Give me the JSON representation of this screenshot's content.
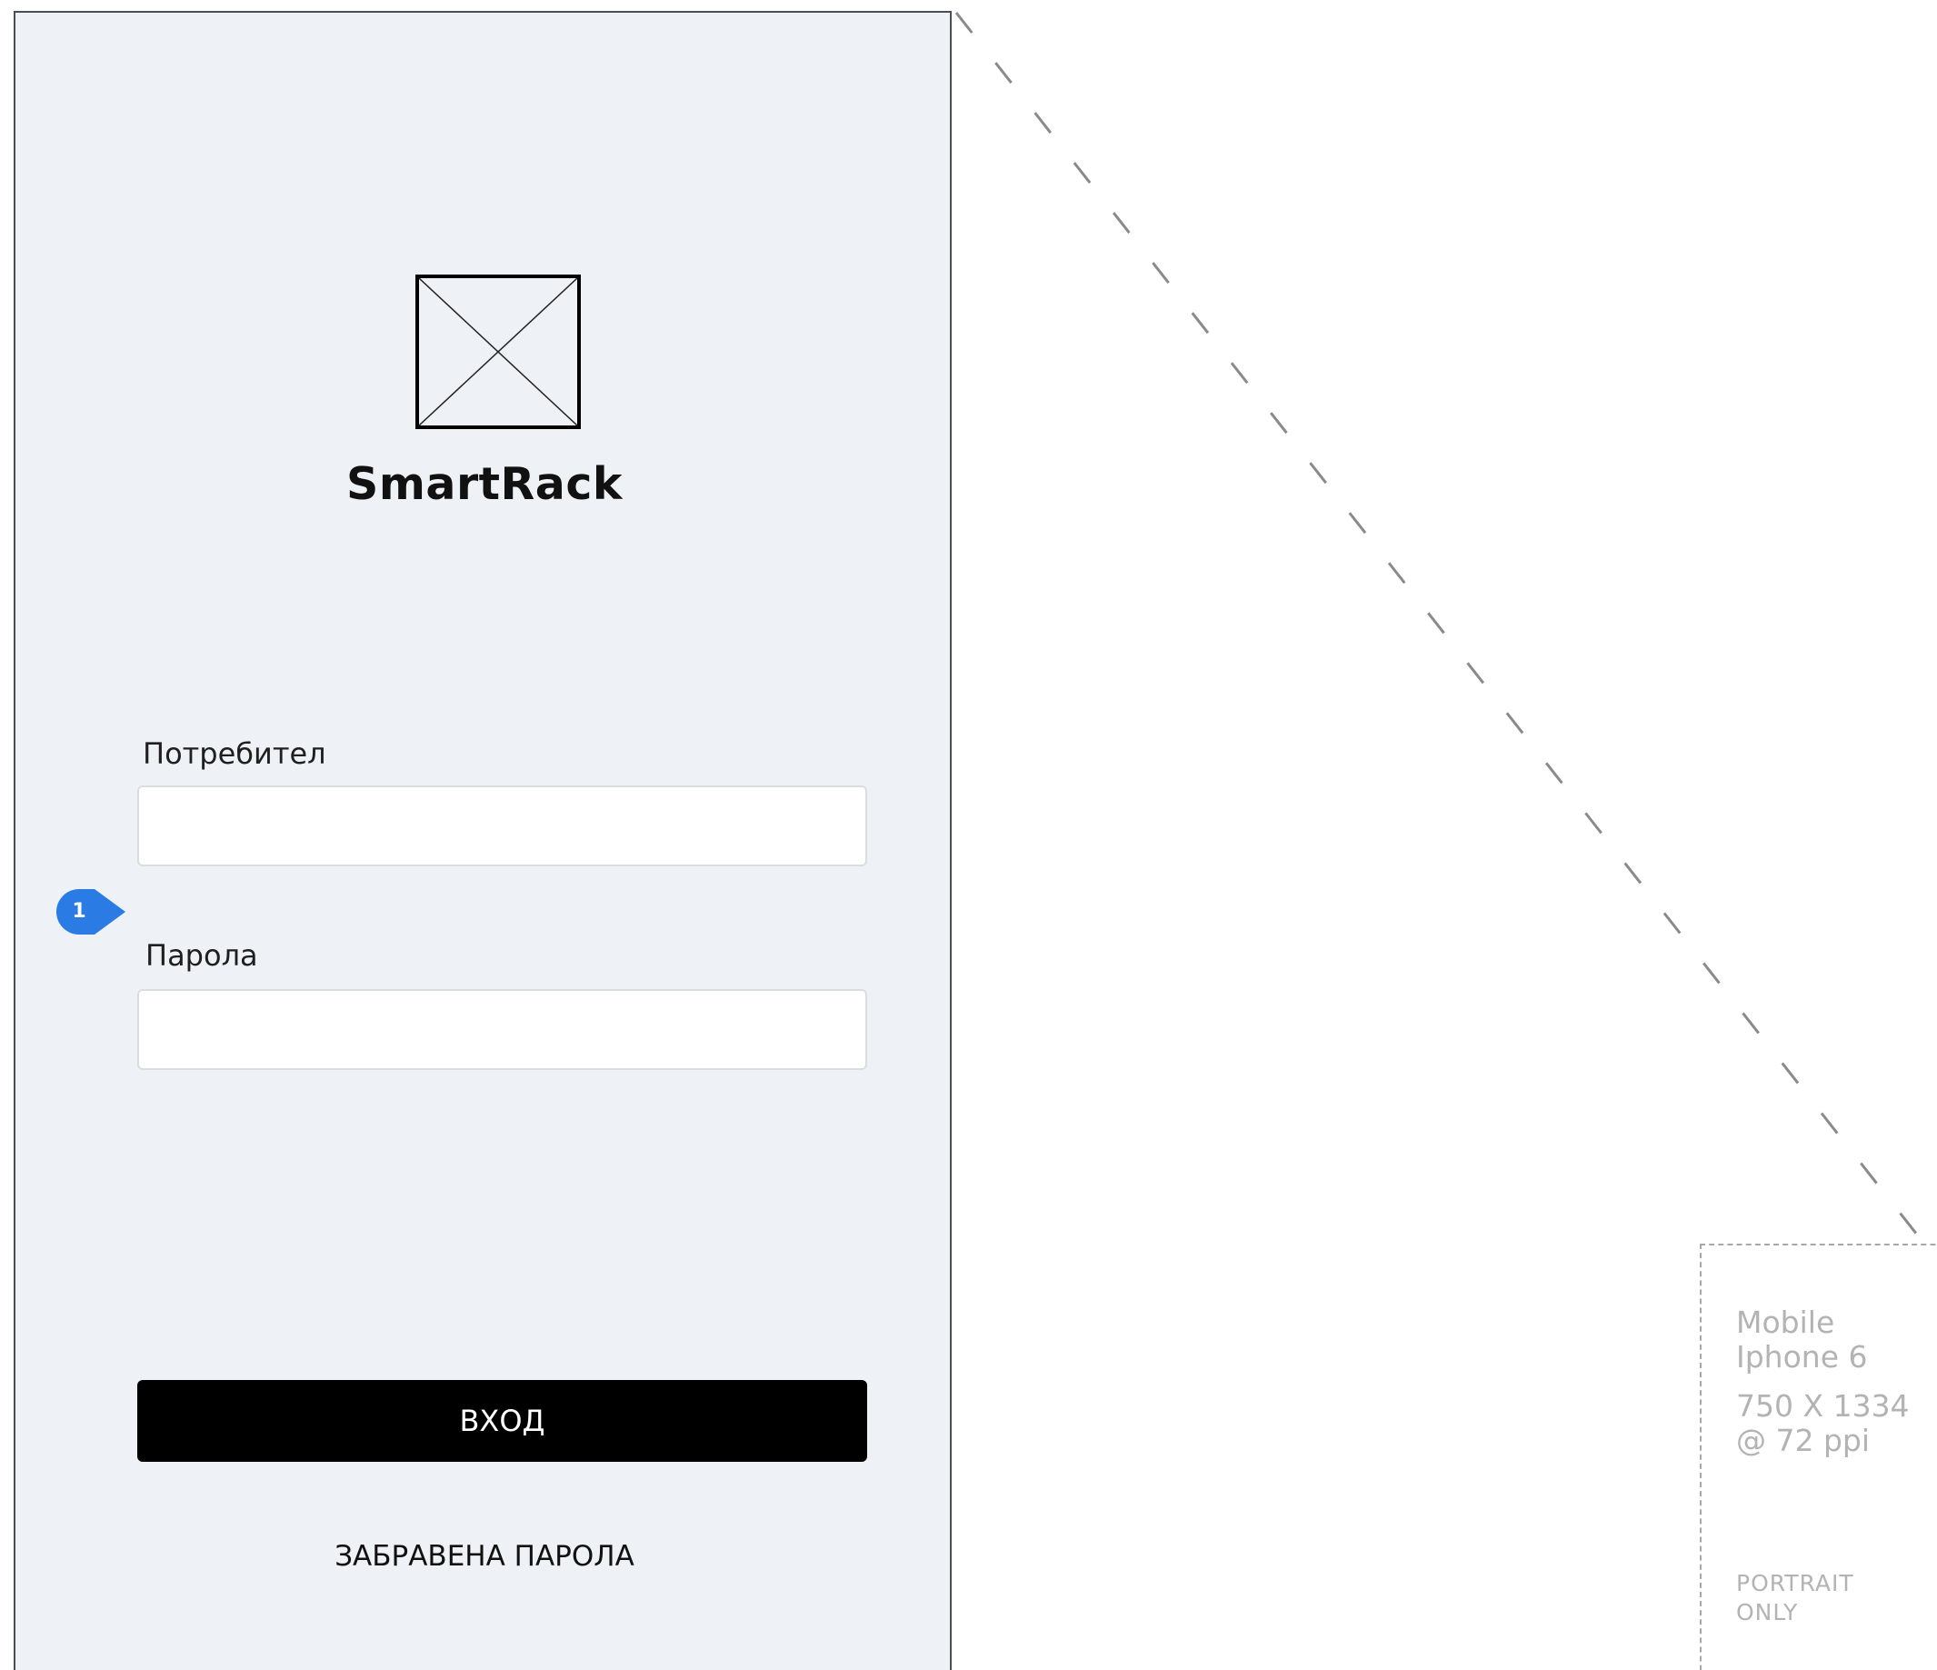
{
  "app": {
    "title": "SmartRack"
  },
  "login_form": {
    "username_label": "Потребител",
    "username_value": "",
    "password_label": "Парола",
    "password_value": "",
    "login_button_label": "ВХОД",
    "forgot_password_label": "ЗАБРАВЕНА ПАРОЛА"
  },
  "annotation": {
    "number": "1",
    "color": "#2a7be4"
  },
  "device_info": {
    "type": "Mobile",
    "model": "Iphone 6",
    "resolution": "750 X 1334",
    "density": "@ 72 ppi",
    "orientation_line1": "PORTRAIT",
    "orientation_line2": "ONLY"
  },
  "icons": {
    "logo": "image-placeholder-icon",
    "annotation": "annotation-marker-icon"
  },
  "colors": {
    "artboard_background": "#eef1f5",
    "button_background": "#000000",
    "button_text": "#ffffff",
    "device_text": "#b3b3b3"
  }
}
